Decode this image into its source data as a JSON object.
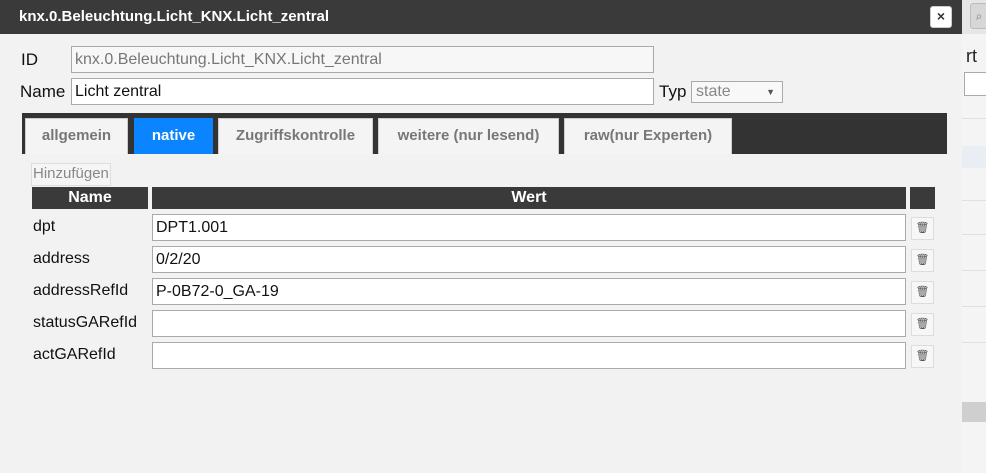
{
  "dialog": {
    "title": "knx.0.Beleuchtung.Licht_KNX.Licht_zentral",
    "close_label": "×"
  },
  "form": {
    "id_label": "ID",
    "id_value": "knx.0.Beleuchtung.Licht_KNX.Licht_zentral",
    "name_label": "Name",
    "name_value": "Licht zentral",
    "type_label": "Typ",
    "type_value": "state"
  },
  "tabs": [
    {
      "label": "allgemein",
      "active": false
    },
    {
      "label": "native",
      "active": true
    },
    {
      "label": "Zugriffskontrolle",
      "active": false
    },
    {
      "label": "weitere (nur lesend)",
      "active": false
    },
    {
      "label": "raw(nur Experten)",
      "active": false
    }
  ],
  "native": {
    "add_label": "Hinzufügen",
    "columns": {
      "name": "Name",
      "value": "Wert"
    },
    "rows": [
      {
        "name": "dpt",
        "value": "DPT1.001"
      },
      {
        "name": "address",
        "value": "0/2/20"
      },
      {
        "name": "addressRefId",
        "value": "P-0B72-0_GA-19"
      },
      {
        "name": "statusGARefId",
        "value": ""
      },
      {
        "name": "actGARefId",
        "value": ""
      }
    ],
    "delete_icon": "trash-icon"
  },
  "background": {
    "heading_fragment": "rt",
    "search_icon": "search-icon"
  },
  "colors": {
    "titlebar": "#3a3a3a",
    "active_tab": "#0a84ff",
    "table_header": "#3a3a3a"
  }
}
